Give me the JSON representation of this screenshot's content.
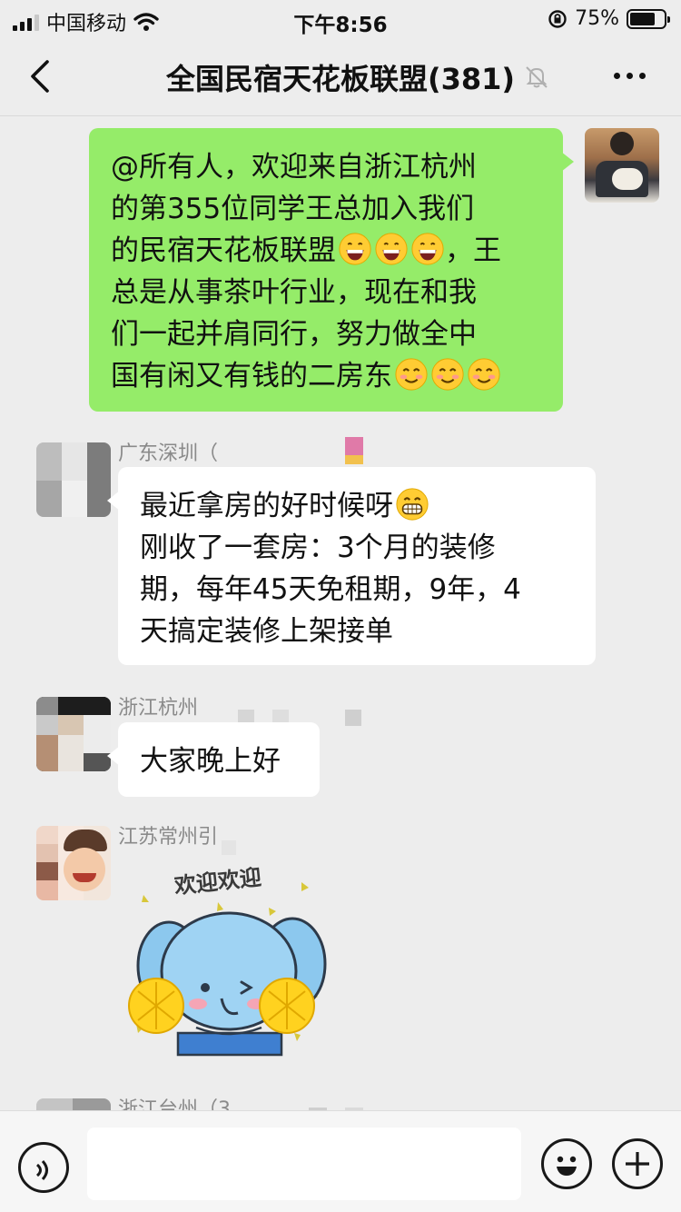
{
  "status_bar": {
    "carrier": "中国移动",
    "time": "下午8:56",
    "battery_percent": "75%",
    "battery_level": 0.75
  },
  "nav": {
    "title": "全国民宿天花板联盟(381)"
  },
  "messages": [
    {
      "from": "me",
      "lines": [
        "@所有人，欢迎来自浙江杭州",
        "的第355位同学王总加入我们",
        "的民宿天花板联盟",
        "，王",
        "总是从事茶叶行业，现在和我",
        "们一起并肩同行，努力做全中",
        "国有闲又有钱的二房东"
      ]
    },
    {
      "from": "other",
      "sender": "广东深圳（",
      "lines": [
        "最近拿房的好时候呀",
        "刚收了一套房：3个月的装修",
        "期，每年45天免租期，9年，4",
        "天搞定装修上架接单"
      ]
    },
    {
      "from": "other",
      "sender": "浙江杭州",
      "lines": [
        "大家晚上好"
      ]
    },
    {
      "from": "other",
      "sender": "江苏常州引",
      "sticker_text": "欢迎欢迎"
    },
    {
      "from": "other",
      "sender": "浙江台州（3"
    }
  ],
  "colors": {
    "my_bubble": "#95ec69",
    "other_bubble": "#ffffff",
    "background": "#ededed"
  }
}
